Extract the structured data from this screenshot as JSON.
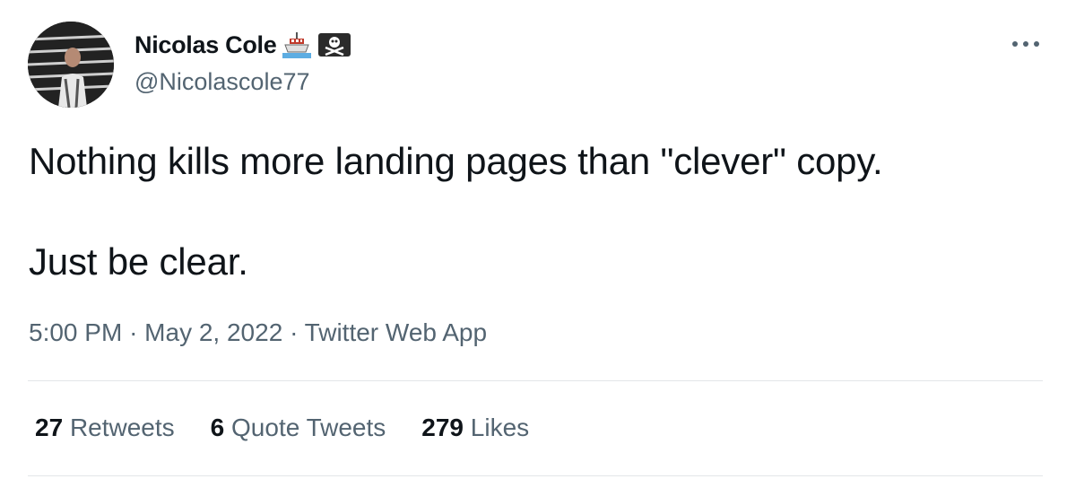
{
  "author": {
    "display_name": "Nicolas Cole",
    "handle": "@Nicolascole77",
    "badges": [
      "ship-emoji-icon",
      "pirate-flag-emoji-icon"
    ]
  },
  "tweet": {
    "line1": "Nothing kills more landing pages than \"clever\" copy.",
    "line2": "Just be clear."
  },
  "meta": {
    "time": "5:00 PM",
    "separator": "·",
    "date": "May 2, 2022",
    "source": "Twitter Web App"
  },
  "stats": {
    "retweets_count": "27",
    "retweets_label": "Retweets",
    "quotes_count": "6",
    "quotes_label": "Quote Tweets",
    "likes_count": "279",
    "likes_label": "Likes"
  },
  "more_icon": "more-horizontal-icon"
}
